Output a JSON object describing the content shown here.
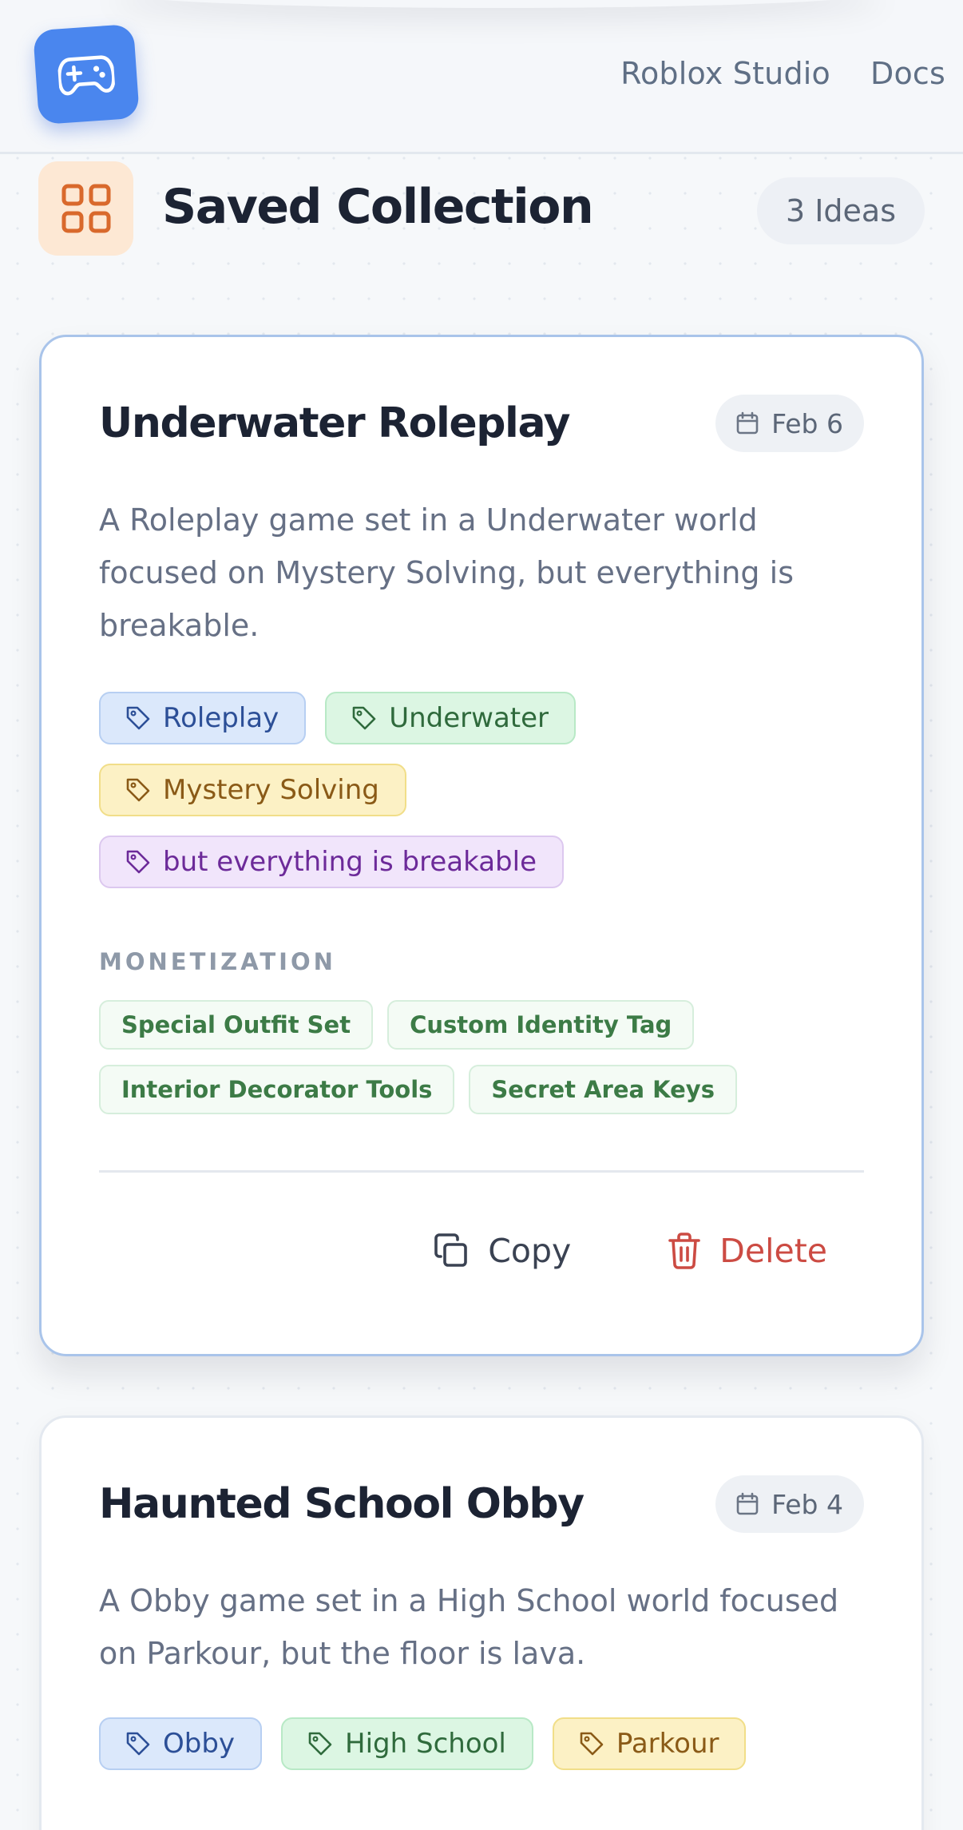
{
  "header": {
    "logo_icon": "gamepad-icon",
    "nav": [
      {
        "label": "Roblox Studio"
      },
      {
        "label": "Docs"
      }
    ]
  },
  "collection": {
    "icon": "grid-icon",
    "title": "Saved Collection",
    "count": "3 Ideas"
  },
  "ideas": [
    {
      "title": "Underwater Roleplay",
      "date": "Feb 6",
      "description": "A Roleplay game set in a Underwater world focused on Mystery Solving, but everything is breakable.",
      "tags": [
        {
          "label": "Roleplay",
          "color": "blue"
        },
        {
          "label": "Underwater",
          "color": "green"
        },
        {
          "label": "Mystery Solving",
          "color": "yellow"
        },
        {
          "label": "but everything is breakable",
          "color": "purple"
        }
      ],
      "monetization_label": "MONETIZATION",
      "monetization": [
        "Special Outfit Set",
        "Custom Identity Tag",
        "Interior Decorator Tools",
        "Secret Area Keys"
      ],
      "copy_label": "Copy",
      "delete_label": "Delete"
    },
    {
      "title": "Haunted School Obby",
      "date": "Feb 4",
      "description": "A Obby game set in a High School world focused on Parkour, but the floor is lava.",
      "tags": [
        {
          "label": "Obby",
          "color": "blue"
        },
        {
          "label": "High School",
          "color": "green"
        },
        {
          "label": "Parkour",
          "color": "yellow"
        }
      ]
    }
  ],
  "colors": {
    "accent": "#4a86ee",
    "danger": "#cc4b43",
    "monetization": "#3c7b46"
  }
}
